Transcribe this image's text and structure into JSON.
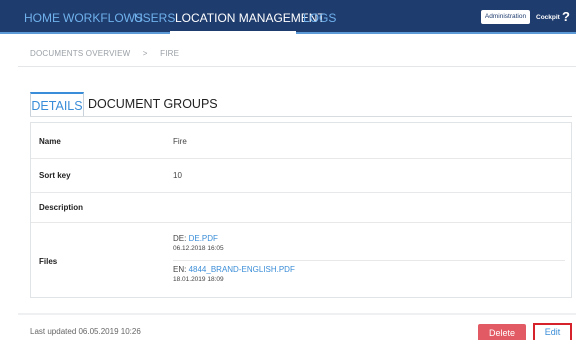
{
  "nav": {
    "items": [
      {
        "label": "HOME"
      },
      {
        "label": "WORKFLOWS"
      },
      {
        "label": "USERS"
      },
      {
        "label": "LOCATION MANAGEMENT"
      },
      {
        "label": "LOGS"
      }
    ],
    "active_index": 3,
    "admin_label": "Administration",
    "cockpit_label": "Cockpit",
    "help_glyph": "?",
    "help_icon": "help-icon"
  },
  "breadcrumb": {
    "items": [
      "DOCUMENTS OVERVIEW",
      "FIRE"
    ],
    "separator": ">"
  },
  "tabs": [
    {
      "label": "DETAILS",
      "active": true
    },
    {
      "label": "DOCUMENT GROUPS",
      "active": false
    }
  ],
  "details": {
    "name_label": "Name",
    "name_value": "Fire",
    "sortkey_label": "Sort key",
    "sortkey_value": "10",
    "description_label": "Description",
    "description_value": "",
    "files_label": "Files",
    "files": [
      {
        "lang": "DE:",
        "name": "DE.PDF",
        "date": "06.12.2018 16:05"
      },
      {
        "lang": "EN:",
        "name": "4844_BRAND-ENGLISH.PDF",
        "date": "18.01.2019 18:09"
      }
    ]
  },
  "footer": {
    "last_updated": "Last updated 06.05.2019 10:26",
    "delete_label": "Delete",
    "edit_label": "Edit"
  },
  "colors": {
    "nav_bg": "#1f3c6e",
    "accent": "#3a8dd8",
    "delete": "#e25a63",
    "highlight": "#d6222a"
  }
}
